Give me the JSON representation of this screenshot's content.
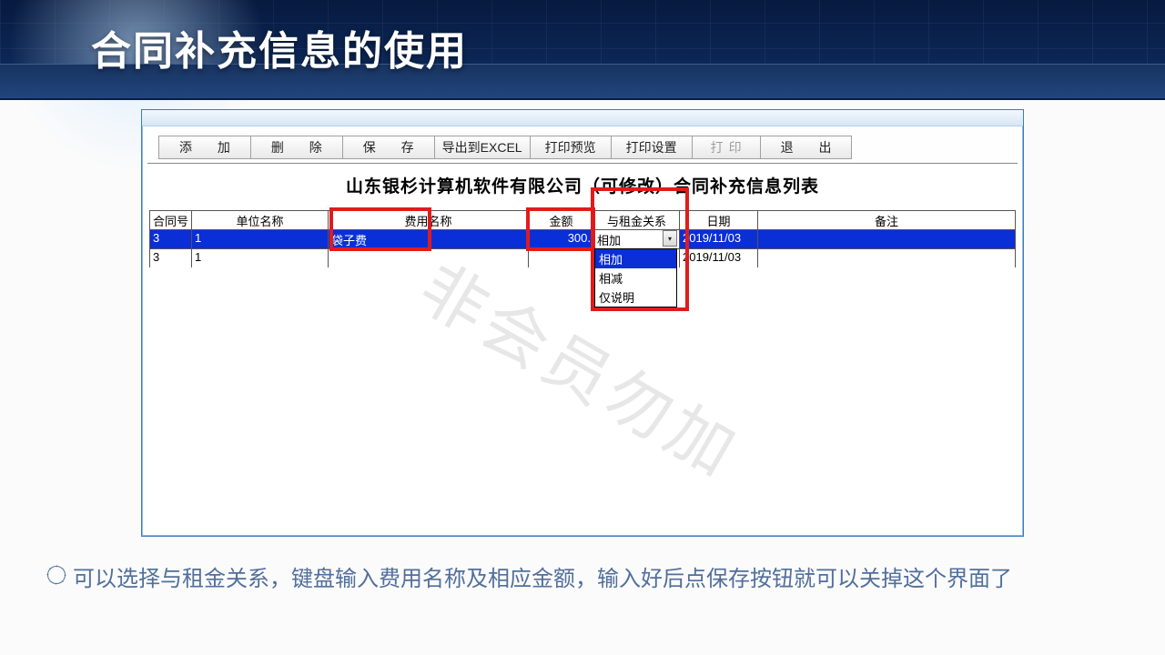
{
  "slide": {
    "title": "合同补充信息的使用",
    "caption": "可以选择与租金关系，键盘输入费用名称及相应金额，输入好后点保存按钮就可以关掉这个界面了",
    "watermark": "非会员勿加"
  },
  "toolbar": {
    "add": "添 加",
    "delete": "删 除",
    "save": "保 存",
    "export": "导出到EXCEL",
    "preview": "打印预览",
    "page_setup": "打印设置",
    "print": "打印",
    "exit": "退 出"
  },
  "form_title": "山东银杉计算机软件有限公司（可修改）合同补充信息列表",
  "columns": {
    "contract_no": "合同号",
    "unit_name": "单位名称",
    "fee_name": "费用名称",
    "amount": "金额",
    "relation": "与租金关系",
    "date": "日期",
    "remark": "备注"
  },
  "rows": [
    {
      "contract_no": "3",
      "unit_name": "1",
      "fee_name": "袋子费",
      "amount": "300.",
      "relation": "相加",
      "date": "2019/11/03",
      "remark": ""
    },
    {
      "contract_no": "3",
      "unit_name": "1",
      "fee_name": "",
      "amount": "",
      "relation": "",
      "date": "2019/11/03",
      "remark": ""
    }
  ],
  "dropdown": {
    "options": [
      "相加",
      "相减",
      "仅说明"
    ],
    "selected": "相加"
  }
}
